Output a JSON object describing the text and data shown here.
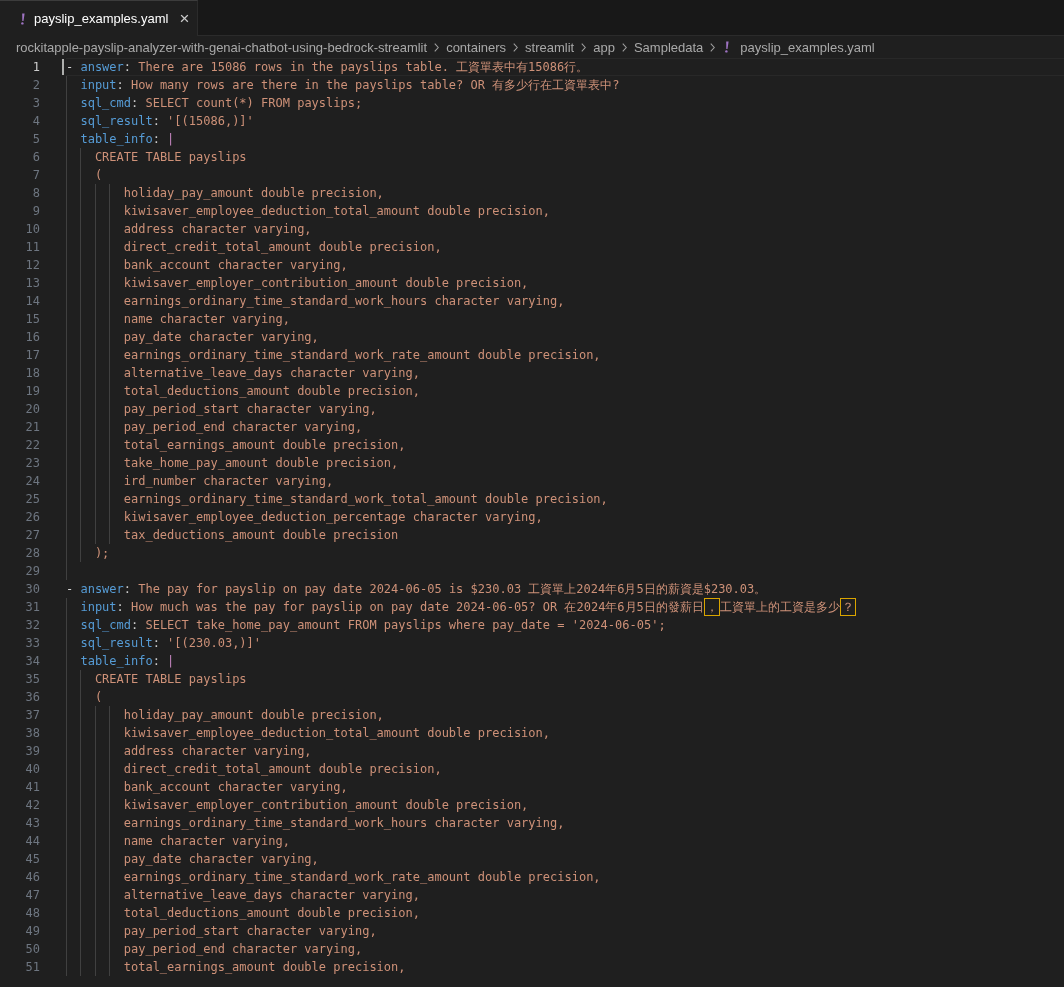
{
  "tab": {
    "label": "payslip_examples.yaml",
    "selected": true,
    "close": "×"
  },
  "breadcrumb": [
    {
      "kind": "folder",
      "label": "rockitapple-payslip-analyzer-with-genai-chatbot-using-bedrock-streamlit"
    },
    {
      "kind": "folder",
      "label": "containers"
    },
    {
      "kind": "folder",
      "label": "streamlit"
    },
    {
      "kind": "folder",
      "label": "app"
    },
    {
      "kind": "folder",
      "label": "Sampledata"
    },
    {
      "kind": "file",
      "label": "payslip_examples.yaml"
    }
  ],
  "entries": [
    {
      "kind": "item",
      "marker": "-",
      "fields": [
        {
          "number": "1",
          "current": true,
          "key": "answer",
          "colon": ":",
          "kind": "scalar",
          "value": "There are 15086 rows in the payslips table. 工資單表中有15086行。"
        },
        {
          "number": "2",
          "current": false,
          "key": "input",
          "colon": ":",
          "kind": "scalar",
          "value": "How many rows are there in the payslips table? OR 有多少行在工資單表中?"
        },
        {
          "number": "3",
          "current": false,
          "key": "sql_cmd",
          "colon": ":",
          "kind": "scalar",
          "value": "SELECT count(*) FROM payslips;"
        },
        {
          "number": "4",
          "current": false,
          "key": "sql_result",
          "colon": ":",
          "kind": "scalar",
          "value": "'[(15086,)]'"
        },
        {
          "number": "5",
          "current": false,
          "key": "table_info",
          "colon": ":",
          "kind": "block",
          "value": "|",
          "children": [
            {
              "number": "6",
              "current": false,
              "text": "CREATE TABLE payslips"
            },
            {
              "number": "7",
              "current": false,
              "text": "(",
              "children": [
                {
                  "number": "8",
                  "current": false,
                  "text": "holiday_pay_amount double precision,"
                },
                {
                  "number": "9",
                  "current": false,
                  "text": "kiwisaver_employee_deduction_total_amount double precision,"
                },
                {
                  "number": "10",
                  "current": false,
                  "text": "address character varying,"
                },
                {
                  "number": "11",
                  "current": false,
                  "text": "direct_credit_total_amount double precision,"
                },
                {
                  "number": "12",
                  "current": false,
                  "text": "bank_account character varying,"
                },
                {
                  "number": "13",
                  "current": false,
                  "text": "kiwisaver_employer_contribution_amount double precision,"
                },
                {
                  "number": "14",
                  "current": false,
                  "text": "earnings_ordinary_time_standard_work_hours character varying,"
                },
                {
                  "number": "15",
                  "current": false,
                  "text": "name character varying,"
                },
                {
                  "number": "16",
                  "current": false,
                  "text": "pay_date character varying,"
                },
                {
                  "number": "17",
                  "current": false,
                  "text": "earnings_ordinary_time_standard_work_rate_amount double precision,"
                },
                {
                  "number": "18",
                  "current": false,
                  "text": "alternative_leave_days character varying,"
                },
                {
                  "number": "19",
                  "current": false,
                  "text": "total_deductions_amount double precision,"
                },
                {
                  "number": "20",
                  "current": false,
                  "text": "pay_period_start character varying,"
                },
                {
                  "number": "21",
                  "current": false,
                  "text": "pay_period_end character varying,"
                },
                {
                  "number": "22",
                  "current": false,
                  "text": "total_earnings_amount double precision,"
                },
                {
                  "number": "23",
                  "current": false,
                  "text": "take_home_pay_amount double precision,"
                },
                {
                  "number": "24",
                  "current": false,
                  "text": "ird_number character varying,"
                },
                {
                  "number": "25",
                  "current": false,
                  "text": "earnings_ordinary_time_standard_work_total_amount double precision,"
                },
                {
                  "number": "26",
                  "current": false,
                  "text": "kiwisaver_employee_deduction_percentage character varying,"
                },
                {
                  "number": "27",
                  "current": false,
                  "text": "tax_deductions_amount double precision"
                }
              ]
            },
            {
              "number": "28",
              "current": false,
              "text": ");"
            }
          ]
        }
      ]
    },
    {
      "kind": "blank",
      "number": "29",
      "current": false
    },
    {
      "kind": "item",
      "marker": "-",
      "fields": [
        {
          "number": "30",
          "current": false,
          "key": "answer",
          "colon": ":",
          "kind": "scalar",
          "value": "The pay for payslip on pay date 2024-06-05 is $230.03 工資單上2024年6月5日的薪資是$230.03。"
        },
        {
          "number": "31",
          "current": false,
          "key": "input",
          "colon": ":",
          "kind": "scalar",
          "value_parts": [
            {
              "text": "How much was the pay for payslip on pay date 2024-06-05? OR 在2024年6月5日的發薪日",
              "flagged": false
            },
            {
              "text": "，",
              "flagged": true
            },
            {
              "text": "工資單上的工資是多少",
              "flagged": false
            },
            {
              "text": "？",
              "flagged": true
            }
          ]
        },
        {
          "number": "32",
          "current": false,
          "key": "sql_cmd",
          "colon": ":",
          "kind": "scalar",
          "value": "SELECT take_home_pay_amount FROM payslips where pay_date = '2024-06-05';"
        },
        {
          "number": "33",
          "current": false,
          "key": "sql_result",
          "colon": ":",
          "kind": "scalar",
          "value": "'[(230.03,)]'"
        },
        {
          "number": "34",
          "current": false,
          "key": "table_info",
          "colon": ":",
          "kind": "block",
          "value": "|",
          "children": [
            {
              "number": "35",
              "current": false,
              "text": "CREATE TABLE payslips"
            },
            {
              "number": "36",
              "current": false,
              "text": "(",
              "children": [
                {
                  "number": "37",
                  "current": false,
                  "text": "holiday_pay_amount double precision,"
                },
                {
                  "number": "38",
                  "current": false,
                  "text": "kiwisaver_employee_deduction_total_amount double precision,"
                },
                {
                  "number": "39",
                  "current": false,
                  "text": "address character varying,"
                },
                {
                  "number": "40",
                  "current": false,
                  "text": "direct_credit_total_amount double precision,"
                },
                {
                  "number": "41",
                  "current": false,
                  "text": "bank_account character varying,"
                },
                {
                  "number": "42",
                  "current": false,
                  "text": "kiwisaver_employer_contribution_amount double precision,"
                },
                {
                  "number": "43",
                  "current": false,
                  "text": "earnings_ordinary_time_standard_work_hours character varying,"
                },
                {
                  "number": "44",
                  "current": false,
                  "text": "name character varying,"
                },
                {
                  "number": "45",
                  "current": false,
                  "text": "pay_date character varying,"
                },
                {
                  "number": "46",
                  "current": false,
                  "text": "earnings_ordinary_time_standard_work_rate_amount double precision,"
                },
                {
                  "number": "47",
                  "current": false,
                  "text": "alternative_leave_days character varying,"
                },
                {
                  "number": "48",
                  "current": false,
                  "text": "total_deductions_amount double precision,"
                },
                {
                  "number": "49",
                  "current": false,
                  "text": "pay_period_start character varying,"
                },
                {
                  "number": "50",
                  "current": false,
                  "text": "pay_period_end character varying,"
                },
                {
                  "number": "51",
                  "current": false,
                  "text": "total_earnings_amount double precision,"
                }
              ]
            }
          ]
        }
      ]
    }
  ]
}
